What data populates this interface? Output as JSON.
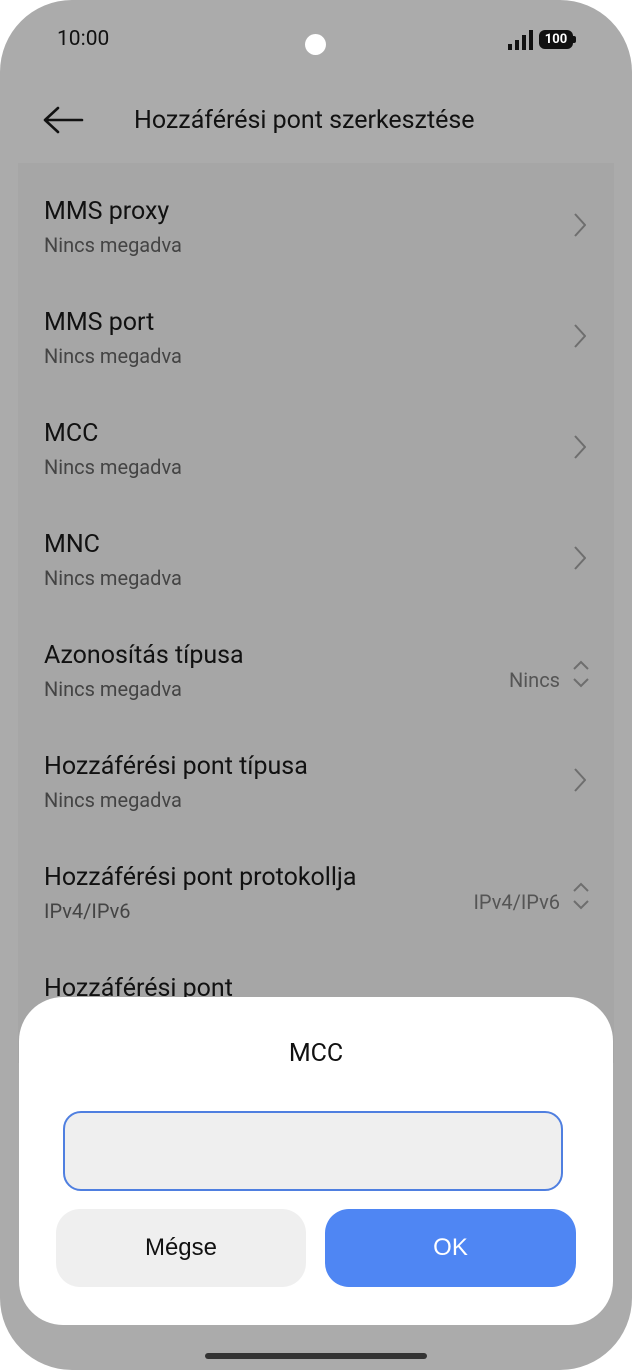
{
  "status_bar": {
    "time": "10:00",
    "battery": "100",
    "signal_icon": "cellular-signal-icon"
  },
  "header": {
    "title": "Hozzáférési pont szerkesztése",
    "back_icon": "back-arrow-icon"
  },
  "settings": {
    "items": [
      {
        "title": "MMS proxy",
        "subtitle": "Nincs megadva",
        "control": "chevron"
      },
      {
        "title": "MMS port",
        "subtitle": "Nincs megadva",
        "control": "chevron"
      },
      {
        "title": "MCC",
        "subtitle": "Nincs megadva",
        "control": "chevron"
      },
      {
        "title": "MNC",
        "subtitle": "Nincs megadva",
        "control": "chevron"
      },
      {
        "title": "Azonosítás típusa",
        "subtitle": "Nincs megadva",
        "value": "Nincs",
        "control": "dropdown"
      },
      {
        "title": "Hozzáférési pont típusa",
        "subtitle": "Nincs megadva",
        "control": "chevron"
      },
      {
        "title": "Hozzáférési pont protokollja",
        "subtitle": "IPv4/IPv6",
        "value": "IPv4/IPv6",
        "control": "dropdown"
      },
      {
        "title": "Hozzáférési pont",
        "subtitle": "",
        "control": "none"
      }
    ]
  },
  "dialog": {
    "title": "MCC",
    "input_value": "",
    "input_placeholder": "",
    "cancel_label": "Mégse",
    "ok_label": "OK"
  },
  "colors": {
    "overlay_background": "#ababab",
    "dialog_background": "#ffffff",
    "accent": "#4f86f3",
    "input_border": "#4f7fe0"
  }
}
